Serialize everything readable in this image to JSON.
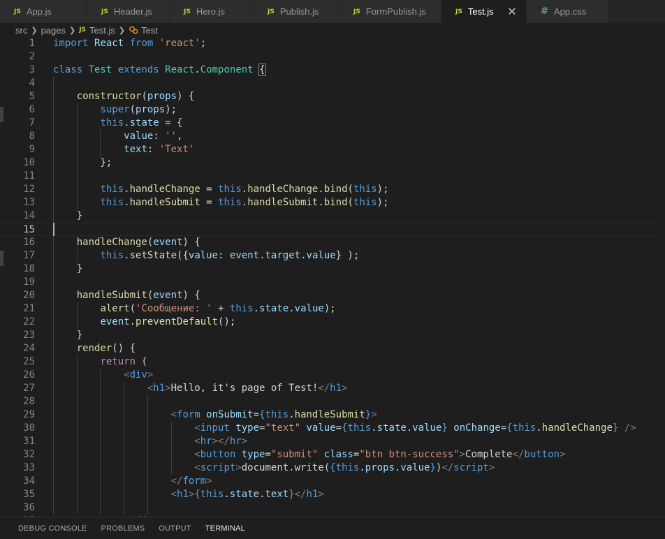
{
  "tabs": [
    {
      "icon": "JS",
      "label": "App.js"
    },
    {
      "icon": "JS",
      "label": "Header.js"
    },
    {
      "icon": "JS",
      "label": "Hero.js"
    },
    {
      "icon": "JS",
      "label": "Publish.js"
    },
    {
      "icon": "JS",
      "label": "FormPublish.js"
    },
    {
      "icon": "JS",
      "label": "Test.js",
      "active": true,
      "close": "✕"
    },
    {
      "icon": "#",
      "label": "App.css"
    }
  ],
  "breadcrumb": {
    "folder1": "src",
    "folder2": "pages",
    "file_icon": "JS",
    "file": "Test.js",
    "symbol": "Test"
  },
  "editor": {
    "current_line": 15,
    "lines": [
      [
        [
          "kw",
          "import "
        ],
        [
          "var",
          "React "
        ],
        [
          "kw",
          "from "
        ],
        [
          "str",
          "'react'"
        ],
        [
          "txt",
          ";"
        ]
      ],
      [],
      [
        [
          "kw",
          "class "
        ],
        [
          "cls",
          "Test "
        ],
        [
          "kw",
          "extends "
        ],
        [
          "cls",
          "React"
        ],
        [
          "txt",
          "."
        ],
        [
          "cls",
          "Component "
        ],
        [
          "box",
          "{"
        ]
      ],
      [],
      [
        [
          "txt",
          "    "
        ],
        [
          "fn",
          "constructor"
        ],
        [
          "txt",
          "("
        ],
        [
          "var",
          "props"
        ],
        [
          "txt",
          ") {"
        ]
      ],
      [
        [
          "txt",
          "        "
        ],
        [
          "kw",
          "super"
        ],
        [
          "txt",
          "("
        ],
        [
          "var",
          "props"
        ],
        [
          "txt",
          ");"
        ]
      ],
      [
        [
          "txt",
          "        "
        ],
        [
          "kw",
          "this"
        ],
        [
          "txt",
          "."
        ],
        [
          "var",
          "state"
        ],
        [
          "txt",
          " = {"
        ]
      ],
      [
        [
          "txt",
          "            "
        ],
        [
          "var",
          "value"
        ],
        [
          "txt",
          ": "
        ],
        [
          "str",
          "''"
        ],
        [
          "txt",
          ","
        ]
      ],
      [
        [
          "txt",
          "            "
        ],
        [
          "var",
          "text"
        ],
        [
          "txt",
          ": "
        ],
        [
          "str",
          "'Text'"
        ]
      ],
      [
        [
          "txt",
          "        };"
        ]
      ],
      [],
      [
        [
          "txt",
          "        "
        ],
        [
          "kw",
          "this"
        ],
        [
          "txt",
          "."
        ],
        [
          "fn",
          "handleChange"
        ],
        [
          "txt",
          " = "
        ],
        [
          "kw",
          "this"
        ],
        [
          "txt",
          "."
        ],
        [
          "fn",
          "handleChange"
        ],
        [
          "txt",
          "."
        ],
        [
          "fn",
          "bind"
        ],
        [
          "txt",
          "("
        ],
        [
          "kw",
          "this"
        ],
        [
          "txt",
          ");"
        ]
      ],
      [
        [
          "txt",
          "        "
        ],
        [
          "kw",
          "this"
        ],
        [
          "txt",
          "."
        ],
        [
          "fn",
          "handleSubmit"
        ],
        [
          "txt",
          " = "
        ],
        [
          "kw",
          "this"
        ],
        [
          "txt",
          "."
        ],
        [
          "fn",
          "handleSubmit"
        ],
        [
          "txt",
          "."
        ],
        [
          "fn",
          "bind"
        ],
        [
          "txt",
          "("
        ],
        [
          "kw",
          "this"
        ],
        [
          "txt",
          ");"
        ]
      ],
      [
        [
          "txt",
          "    }"
        ]
      ],
      [],
      [
        [
          "txt",
          "    "
        ],
        [
          "fn",
          "handleChange"
        ],
        [
          "txt",
          "("
        ],
        [
          "var",
          "event"
        ],
        [
          "txt",
          ") {"
        ]
      ],
      [
        [
          "txt",
          "        "
        ],
        [
          "kw",
          "this"
        ],
        [
          "txt",
          "."
        ],
        [
          "fn",
          "setState"
        ],
        [
          "txt",
          "({"
        ],
        [
          "var",
          "value"
        ],
        [
          "txt",
          ": "
        ],
        [
          "var",
          "event"
        ],
        [
          "txt",
          "."
        ],
        [
          "var",
          "target"
        ],
        [
          "txt",
          "."
        ],
        [
          "var",
          "value"
        ],
        [
          "txt",
          "} );"
        ]
      ],
      [
        [
          "txt",
          "    }"
        ]
      ],
      [],
      [
        [
          "txt",
          "    "
        ],
        [
          "fn",
          "handleSubmit"
        ],
        [
          "txt",
          "("
        ],
        [
          "var",
          "event"
        ],
        [
          "txt",
          ") {"
        ]
      ],
      [
        [
          "txt",
          "        "
        ],
        [
          "fn",
          "alert"
        ],
        [
          "txt",
          "("
        ],
        [
          "str",
          "'Сообщение: '"
        ],
        [
          "txt",
          " + "
        ],
        [
          "kw",
          "this"
        ],
        [
          "txt",
          "."
        ],
        [
          "var",
          "state"
        ],
        [
          "txt",
          "."
        ],
        [
          "var",
          "value"
        ],
        [
          "txt",
          ");"
        ]
      ],
      [
        [
          "txt",
          "        "
        ],
        [
          "var",
          "event"
        ],
        [
          "txt",
          "."
        ],
        [
          "fn",
          "preventDefault"
        ],
        [
          "txt",
          "();"
        ]
      ],
      [
        [
          "txt",
          "    }"
        ]
      ],
      [
        [
          "txt",
          "    "
        ],
        [
          "fn",
          "render"
        ],
        [
          "txt",
          "() {"
        ]
      ],
      [
        [
          "txt",
          "        "
        ],
        [
          "ctrl",
          "return"
        ],
        [
          "txt",
          " ("
        ]
      ],
      [
        [
          "txt",
          "            "
        ],
        [
          "tagb",
          "<"
        ],
        [
          "tag",
          "div"
        ],
        [
          "tagb",
          ">"
        ]
      ],
      [
        [
          "txt",
          "                "
        ],
        [
          "tagb",
          "<"
        ],
        [
          "tag",
          "h1"
        ],
        [
          "tagb",
          ">"
        ],
        [
          "txt",
          "Hello, it's page of Test!"
        ],
        [
          "tagb",
          "</"
        ],
        [
          "tag",
          "h1"
        ],
        [
          "tagb",
          ">"
        ]
      ],
      [],
      [
        [
          "txt",
          "                    "
        ],
        [
          "tagb",
          "<"
        ],
        [
          "tag",
          "form "
        ],
        [
          "attr",
          "onSubmit"
        ],
        [
          "txt",
          "="
        ],
        [
          "kw",
          "{"
        ],
        [
          "kw",
          "this"
        ],
        [
          "txt",
          "."
        ],
        [
          "fn",
          "handleSubmit"
        ],
        [
          "kw",
          "}"
        ],
        [
          "tagb",
          ">"
        ]
      ],
      [
        [
          "txt",
          "                        "
        ],
        [
          "tagb",
          "<"
        ],
        [
          "tag",
          "input "
        ],
        [
          "attr",
          "type"
        ],
        [
          "txt",
          "="
        ],
        [
          "str",
          "\"text\" "
        ],
        [
          "attr",
          "value"
        ],
        [
          "txt",
          "="
        ],
        [
          "kw",
          "{"
        ],
        [
          "kw",
          "this"
        ],
        [
          "txt",
          "."
        ],
        [
          "var",
          "state"
        ],
        [
          "txt",
          "."
        ],
        [
          "var",
          "value"
        ],
        [
          "kw",
          "}"
        ],
        [
          "txt",
          " "
        ],
        [
          "attr",
          "onChange"
        ],
        [
          "txt",
          "="
        ],
        [
          "kw",
          "{"
        ],
        [
          "kw",
          "this"
        ],
        [
          "txt",
          "."
        ],
        [
          "fn",
          "handleChange"
        ],
        [
          "kw",
          "}"
        ],
        [
          "txt",
          " "
        ],
        [
          "tagb",
          "/>"
        ]
      ],
      [
        [
          "txt",
          "                        "
        ],
        [
          "tagb",
          "<"
        ],
        [
          "tag",
          "hr"
        ],
        [
          "tagb",
          "></"
        ],
        [
          "tag",
          "hr"
        ],
        [
          "tagb",
          ">"
        ]
      ],
      [
        [
          "txt",
          "                        "
        ],
        [
          "tagb",
          "<"
        ],
        [
          "tag",
          "button "
        ],
        [
          "attr",
          "type"
        ],
        [
          "txt",
          "="
        ],
        [
          "str",
          "\"submit\" "
        ],
        [
          "attr",
          "class"
        ],
        [
          "txt",
          "="
        ],
        [
          "str",
          "\"btn btn-success\""
        ],
        [
          "tagb",
          ">"
        ],
        [
          "txt",
          "Complete"
        ],
        [
          "tagb",
          "</"
        ],
        [
          "tag",
          "button"
        ],
        [
          "tagb",
          ">"
        ]
      ],
      [
        [
          "txt",
          "                        "
        ],
        [
          "tagb",
          "<"
        ],
        [
          "tag",
          "script"
        ],
        [
          "tagb",
          ">"
        ],
        [
          "txt",
          "document.write("
        ],
        [
          "kw",
          "{"
        ],
        [
          "kw",
          "this"
        ],
        [
          "txt",
          "."
        ],
        [
          "var",
          "props"
        ],
        [
          "txt",
          "."
        ],
        [
          "var",
          "value"
        ],
        [
          "kw",
          "}"
        ],
        [
          "txt",
          ")"
        ],
        [
          "tagb",
          "</"
        ],
        [
          "tag",
          "script"
        ],
        [
          "tagb",
          ">"
        ]
      ],
      [
        [
          "txt",
          "                    "
        ],
        [
          "tagb",
          "</"
        ],
        [
          "tag",
          "form"
        ],
        [
          "tagb",
          ">"
        ]
      ],
      [
        [
          "txt",
          "                    "
        ],
        [
          "tagb",
          "<"
        ],
        [
          "tag",
          "h1"
        ],
        [
          "tagb",
          ">"
        ],
        [
          "kw",
          "{"
        ],
        [
          "kw",
          "this"
        ],
        [
          "txt",
          "."
        ],
        [
          "var",
          "state"
        ],
        [
          "txt",
          "."
        ],
        [
          "var",
          "text"
        ],
        [
          "kw",
          "}"
        ],
        [
          "tagb",
          "</"
        ],
        [
          "tag",
          "h1"
        ],
        [
          "tagb",
          ">"
        ]
      ],
      [],
      [
        [
          "txt",
          "            "
        ],
        [
          "tagb",
          "</"
        ],
        [
          "tag",
          "div"
        ],
        [
          "tagb",
          ">"
        ]
      ]
    ]
  },
  "panel": {
    "tabs": [
      {
        "label": "DEBUG CONSOLE"
      },
      {
        "label": "PROBLEMS"
      },
      {
        "label": "OUTPUT"
      },
      {
        "label": "TERMINAL",
        "active": true
      }
    ]
  }
}
